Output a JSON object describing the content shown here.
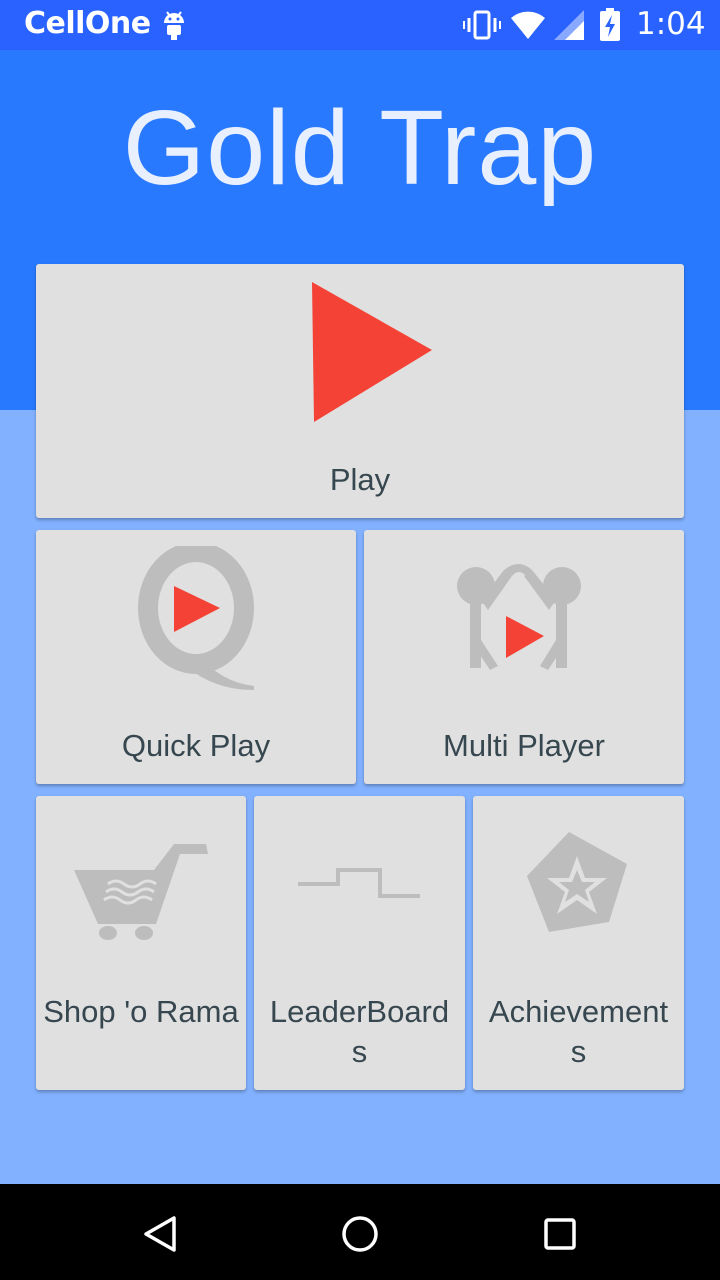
{
  "status_bar": {
    "carrier": "CellOne",
    "time": "1:04",
    "icons": [
      "android-icon",
      "vibrate-icon",
      "wifi-icon",
      "signal-icon",
      "battery-charging-icon"
    ]
  },
  "app": {
    "title": "Gold Trap"
  },
  "menu": {
    "play": {
      "label": "Play",
      "icon": "play-icon"
    },
    "quick_play": {
      "label": "Quick Play",
      "icon": "quick-play-icon"
    },
    "multi_player": {
      "label": "Multi Player",
      "icon": "multi-player-icon"
    },
    "shop": {
      "label": "Shop 'o Rama",
      "icon": "shopping-cart-icon"
    },
    "leaderboards": {
      "label_line1": "LeaderBoard",
      "label_line2": "s",
      "icon": "leaderboard-icon"
    },
    "achievements": {
      "label_line1": "Achievement",
      "label_line2": "s",
      "icon": "achievements-star-icon"
    }
  },
  "navigation": {
    "buttons": [
      "back-icon",
      "home-icon",
      "recents-icon"
    ]
  },
  "colors": {
    "status_bar": "#2962ff",
    "header": "#2979ff",
    "background": "#82b1ff",
    "tile": "#e0e0e0",
    "accent_red": "#f44336",
    "icon_gray": "#bdbdbd",
    "label_text": "#37474f"
  }
}
